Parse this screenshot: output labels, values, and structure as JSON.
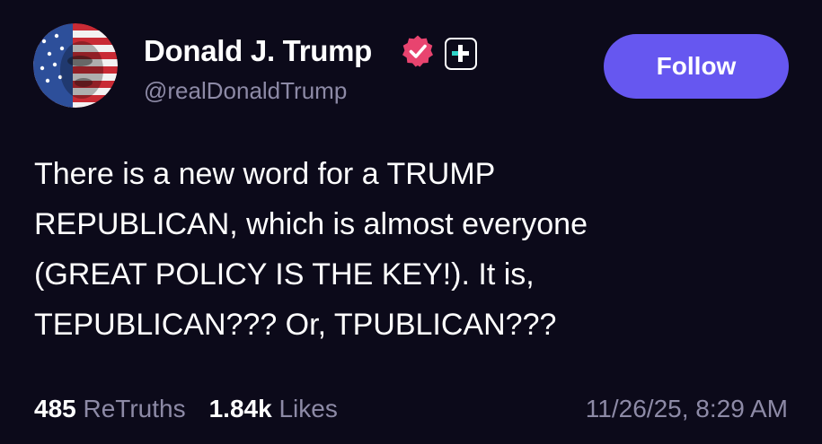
{
  "author": {
    "display_name": "Donald J. Trump",
    "handle": "@realDonaldTrump",
    "verified_icon": "verified-badge-icon",
    "plus_icon": "plus-square-icon",
    "avatar": "flag-painted-portrait"
  },
  "follow_button": {
    "label": "Follow",
    "color": "#6657f0"
  },
  "post": {
    "text": "There is a new word for a TRUMP\nREPUBLICAN, which is almost everyone\n(GREAT POLICY IS THE KEY!). It is,\nTEPUBLICAN??? Or, TPUBLICAN???"
  },
  "stats": {
    "retruths_count": "485",
    "retruths_label": "ReTruths",
    "likes_count": "1.84k",
    "likes_label": "Likes"
  },
  "timestamp": "11/26/25, 8:29 AM",
  "colors": {
    "background": "#0c0a1a",
    "muted_text": "#8d8aa6",
    "verified_badge": "#e8446f",
    "plus_accent": "#2fd3c8"
  }
}
